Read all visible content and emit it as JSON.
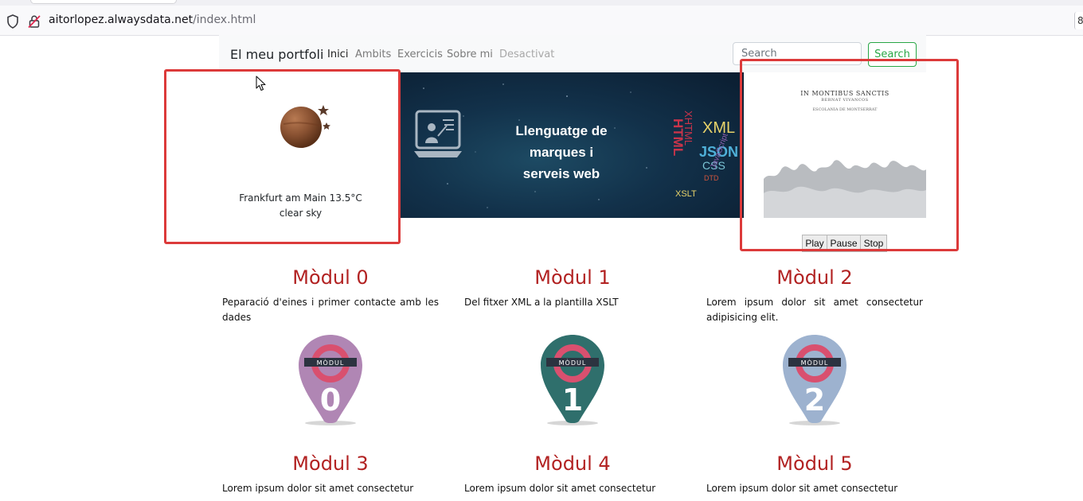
{
  "browser": {
    "url_host": "aitorlopez.alwaysdata.net",
    "url_path": "/index.html",
    "edge_tab_text": "8"
  },
  "navbar": {
    "brand": "El meu portfoli",
    "items": [
      {
        "label": "Inici",
        "state": "active"
      },
      {
        "label": "Ambits",
        "state": "normal"
      },
      {
        "label": "Exercicis",
        "state": "normal"
      },
      {
        "label": "Sobre mi",
        "state": "normal"
      },
      {
        "label": "Desactivat",
        "state": "disabled"
      }
    ],
    "search_placeholder": "Search",
    "search_button": "Search",
    "accent": "#28a745"
  },
  "weather": {
    "location_temp": "Frankfurt am Main 13.5°C",
    "description": "clear sky",
    "icon": "moon-stars-icon"
  },
  "banner": {
    "line1": "Llenguatge de marques i",
    "line2": "serveis web",
    "icon": "teacher-laptop-icon",
    "word_cloud": "XML JSON HTML XHTML CSS JavaScript XSLT DTD"
  },
  "audio_player": {
    "album_title": "IN MONTIBUS SANCTIS",
    "album_artist": "BERNAT VIVANCOS",
    "album_choir": "ESCOLANIA DE MONTSERRAT",
    "controls": [
      "Play",
      "Pause",
      "Stop"
    ]
  },
  "modules": [
    {
      "title": "Mòdul 0",
      "description": "Peparació d'eines i primer contacte amb les dades",
      "pin_number": "0",
      "pin_label": "MÒDUL",
      "color": "#b086b4"
    },
    {
      "title": "Mòdul 1",
      "description": "Del fitxer XML a la plantilla XSLT",
      "pin_number": "1",
      "pin_label": "MÒDUL",
      "color": "#2f6f6c"
    },
    {
      "title": "Mòdul 2",
      "description": "Lorem ipsum dolor sit amet consectetur adipisicing elit.",
      "pin_number": "2",
      "pin_label": "MÒDUL",
      "color": "#9db2cf"
    },
    {
      "title": "Mòdul 3",
      "description": "Lorem ipsum dolor sit amet consectetur"
    },
    {
      "title": "Mòdul 4",
      "description": "Lorem ipsum dolor sit amet consectetur"
    },
    {
      "title": "Mòdul 5",
      "description": "Lorem ipsum dolor sit amet consectetur"
    }
  ],
  "colors": {
    "module_title": "#b22222",
    "callout": "#dc3a3a",
    "pin_ring": "#d9506f"
  }
}
